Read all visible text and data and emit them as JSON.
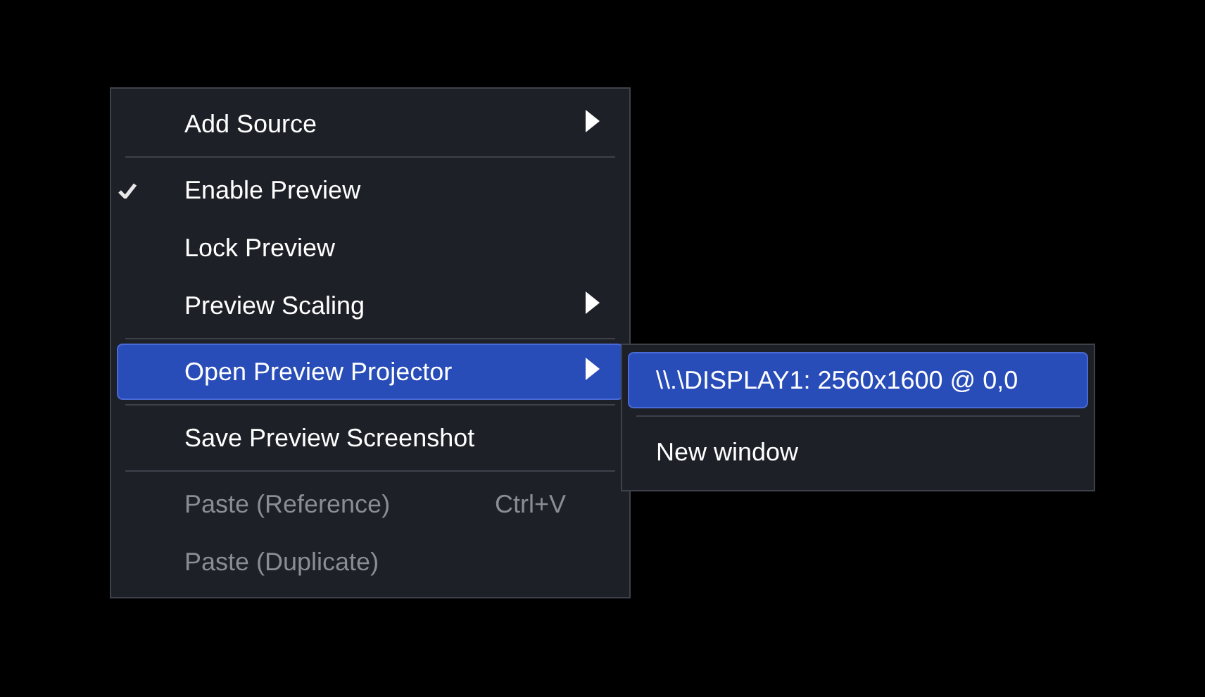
{
  "context_menu": {
    "items": [
      {
        "kind": "item",
        "label": "Add Source",
        "checked": false,
        "disabled": false,
        "selected": false,
        "has_submenu": true
      },
      {
        "kind": "separator"
      },
      {
        "kind": "item",
        "label": "Enable Preview",
        "checked": true,
        "disabled": false,
        "selected": false,
        "has_submenu": false
      },
      {
        "kind": "item",
        "label": "Lock Preview",
        "checked": false,
        "disabled": false,
        "selected": false,
        "has_submenu": false
      },
      {
        "kind": "item",
        "label": "Preview Scaling",
        "checked": false,
        "disabled": false,
        "selected": false,
        "has_submenu": true
      },
      {
        "kind": "separator"
      },
      {
        "kind": "item",
        "label": "Open Preview Projector",
        "checked": false,
        "disabled": false,
        "selected": true,
        "has_submenu": true
      },
      {
        "kind": "separator"
      },
      {
        "kind": "item",
        "label": "Save Preview Screenshot",
        "checked": false,
        "disabled": false,
        "selected": false,
        "has_submenu": false
      },
      {
        "kind": "separator"
      },
      {
        "kind": "item",
        "label": "Paste (Reference)",
        "shortcut": "Ctrl+V",
        "checked": false,
        "disabled": true,
        "selected": false,
        "has_submenu": false
      },
      {
        "kind": "item",
        "label": "Paste (Duplicate)",
        "checked": false,
        "disabled": true,
        "selected": false,
        "has_submenu": false
      }
    ]
  },
  "submenu": {
    "items": [
      {
        "kind": "item",
        "label": "\\\\.\\DISPLAY1: 2560x1600 @ 0,0",
        "selected": true
      },
      {
        "kind": "separator"
      },
      {
        "kind": "item",
        "label": "New window",
        "selected": false
      }
    ]
  }
}
